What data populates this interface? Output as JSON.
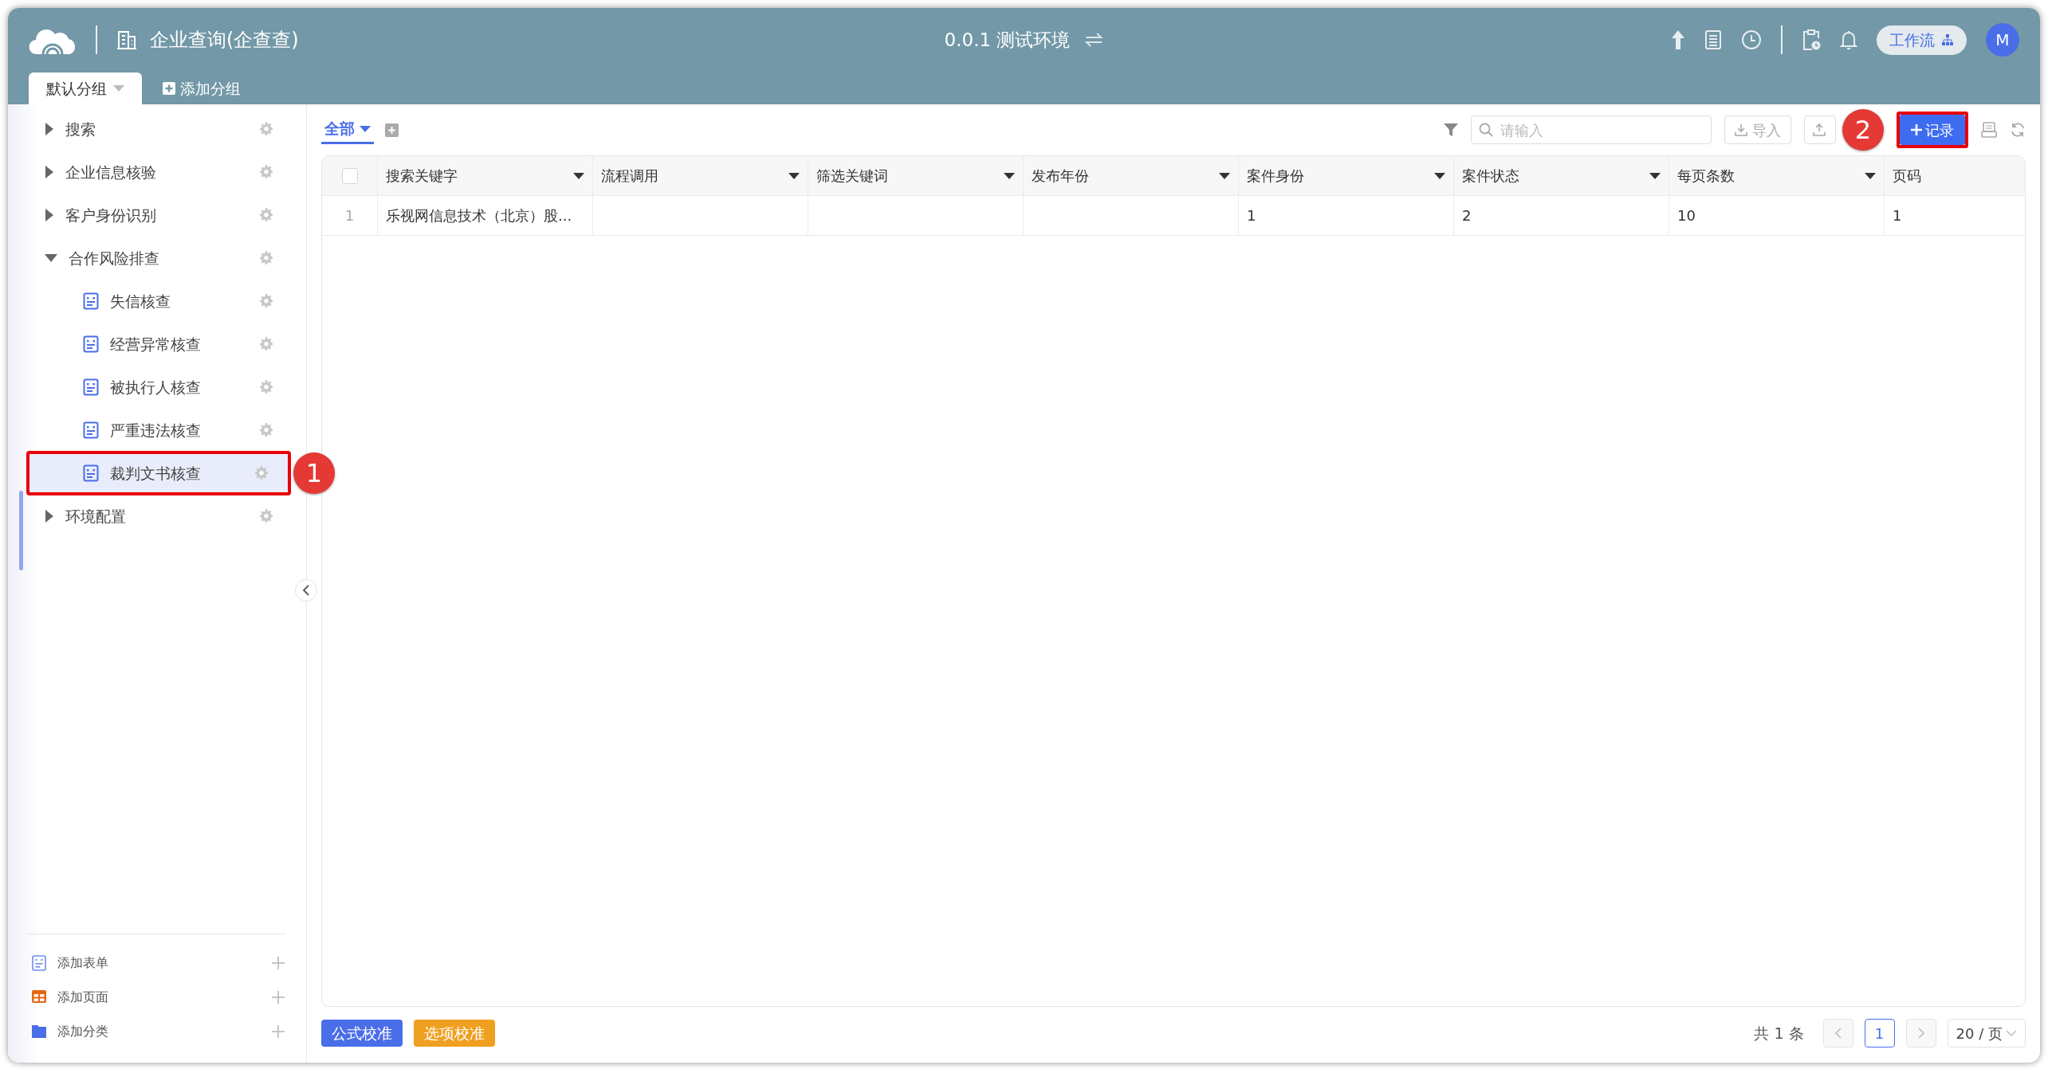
{
  "header": {
    "app_title": "企业查询(企查查)",
    "environment": "0.0.1 测试环境",
    "workflow_button": "工作流",
    "avatar": "M"
  },
  "group_tabs": [
    {
      "label": "默认分组",
      "selected": true
    }
  ],
  "add_group": "添加分组",
  "sidebar": {
    "items": [
      {
        "kind": "folder",
        "label": "搜索",
        "expanded": false,
        "selected": false
      },
      {
        "kind": "folder",
        "label": "企业信息核验",
        "expanded": false,
        "selected": false
      },
      {
        "kind": "folder",
        "label": "客户身份识别",
        "expanded": false,
        "selected": false
      },
      {
        "kind": "folder",
        "label": "合作风险排查",
        "expanded": true,
        "selected": false,
        "children": [
          {
            "kind": "form",
            "label": "失信核查",
            "selected": false,
            "highlighted": false
          },
          {
            "kind": "form",
            "label": "经营异常核查",
            "selected": false,
            "highlighted": false
          },
          {
            "kind": "form",
            "label": "被执行人核查",
            "selected": false,
            "highlighted": false
          },
          {
            "kind": "form",
            "label": "严重违法核查",
            "selected": false,
            "highlighted": false
          },
          {
            "kind": "form",
            "label": "裁判文书核查",
            "selected": true,
            "highlighted": true,
            "callout": "1"
          }
        ]
      },
      {
        "kind": "folder",
        "label": "环境配置",
        "expanded": false,
        "selected": false
      }
    ],
    "bottom_actions": [
      {
        "kind": "form",
        "label": "添加表单"
      },
      {
        "kind": "page",
        "label": "添加页面"
      },
      {
        "kind": "category",
        "label": "添加分类"
      }
    ]
  },
  "view_tabs": [
    {
      "label": "全部",
      "selected": true
    }
  ],
  "search": {
    "placeholder": "请输入"
  },
  "toolbar": {
    "import_button": "导入",
    "record_button": {
      "label": "记录",
      "highlighted": true,
      "callout": "2"
    }
  },
  "table": {
    "columns": [
      "搜索关键字",
      "流程调用",
      "筛选关键词",
      "发布年份",
      "案件身份",
      "案件状态",
      "每页条数",
      "页码"
    ],
    "select_all": {
      "checked": false
    },
    "rows": [
      {
        "number": "1",
        "cells": [
          "乐视网信息技术（北京）股...",
          null,
          null,
          null,
          "1",
          "2",
          "10",
          "1"
        ]
      }
    ]
  },
  "footer_buttons": [
    {
      "label": "公式校准",
      "color": "#4a6ee8"
    },
    {
      "label": "选项校准",
      "color": "#f0a020"
    }
  ],
  "pagination": {
    "total": "共 1 条",
    "pages": [
      {
        "label": "1",
        "selected": true
      }
    ],
    "page_size": "20 / 页"
  }
}
